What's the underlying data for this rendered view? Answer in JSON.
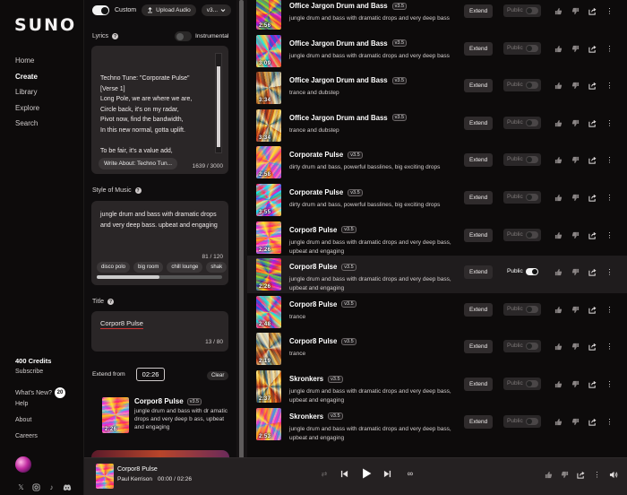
{
  "brand": "SUNO",
  "nav": [
    "Home",
    "Create",
    "Library",
    "Explore",
    "Search"
  ],
  "side_bottom": {
    "credits": "400 Credits",
    "subscribe": "Subscribe",
    "whats_new": "What's New?",
    "whats_new_count": "20",
    "help": "Help",
    "about": "About",
    "careers": "Careers"
  },
  "create": {
    "custom_label": "Custom",
    "upload_label": "Upload Audio",
    "version_label": "v3...",
    "lyrics_label": "Lyrics",
    "instrumental_label": "Instrumental",
    "lyrics_text": "Techno Tune: \"Corporate Pulse\"\n[Verse 1]\nLong Pole, we are where we are,\nCircle back, it's on my radar,\nPivot now, find the bandwidth,\nIn this new normal, gotta uplift.\n\nTo be fair, it's a value add,",
    "write_about": "Write About: Techno Tun...",
    "lyrics_count": "1639 / 3000",
    "style_label": "Style of Music",
    "style_text": "jungle drum and bass with dramatic drops and very deep bass.  upbeat and engaging",
    "style_count": "81 / 120",
    "chips": [
      "disco polo",
      "big room",
      "chill lounge",
      "shak"
    ],
    "title_label": "Title",
    "title_value": "Corpor8 Pulse",
    "title_count": "13 / 80",
    "extend_from_label": "Extend from",
    "extend_time": "02:26",
    "clear_label": "Clear",
    "extend_song": {
      "title": "Corpor8 Pulse",
      "version": "v3.5",
      "desc": "jungle drum and bass with dr amatic drops and very deep b ass, upbeat and engaging",
      "duration": "2:26"
    }
  },
  "songs": [
    {
      "title": "Office Jargon Drum and Bass",
      "version": "v3.5",
      "desc": "jungle drum and bass with dramatic drops and very deep bass",
      "duration": "2:56",
      "public": false,
      "extend": "Extend",
      "public_label": "Public"
    },
    {
      "title": "Office Jargon Drum and Bass",
      "version": "v3.5",
      "desc": "jungle drum and bass with dramatic drops and very deep bass",
      "duration": "3:09",
      "public": false,
      "extend": "Extend",
      "public_label": "Public"
    },
    {
      "title": "Office Jargon Drum and Bass",
      "version": "v3.5",
      "desc": "trance and dubstep",
      "duration": "3:34",
      "public": false,
      "extend": "Extend",
      "public_label": "Public"
    },
    {
      "title": "Office Jargon Drum and Bass",
      "version": "v3.5",
      "desc": "trance and dubstep",
      "duration": "3:34",
      "public": false,
      "extend": "Extend",
      "public_label": "Public"
    },
    {
      "title": "Corporate Pulse",
      "version": "v3.5",
      "desc": "dirty drum and bass, powerful basslines, big exciting drops",
      "duration": "2:58",
      "public": false,
      "extend": "Extend",
      "public_label": "Public"
    },
    {
      "title": "Corporate Pulse",
      "version": "v3.5",
      "desc": "dirty drum and bass, powerful basslines, big exciting drops",
      "duration": "3:55",
      "public": false,
      "extend": "Extend",
      "public_label": "Public"
    },
    {
      "title": "Corpor8 Pulse",
      "version": "v3.5",
      "desc": "jungle drum and bass with dramatic drops and very deep bass, upbeat and engaging",
      "duration": "2:26",
      "public": false,
      "extend": "Extend",
      "public_label": "Public"
    },
    {
      "title": "Corpor8 Pulse",
      "version": "v3.5",
      "desc": "jungle drum and bass with dramatic drops and very deep bass, upbeat and engaging",
      "duration": "2:26",
      "public": true,
      "extend": "Extend",
      "public_label": "Public"
    },
    {
      "title": "Corpor8 Pulse",
      "version": "v3.5",
      "desc": "trance",
      "duration": "2:48",
      "public": false,
      "extend": "Extend",
      "public_label": "Public"
    },
    {
      "title": "Corpor8 Pulse",
      "version": "v3.5",
      "desc": "trance",
      "duration": "2:19",
      "public": false,
      "extend": "Extend",
      "public_label": "Public"
    },
    {
      "title": "Skronkers",
      "version": "v3.5",
      "desc": "jungle drum and bass with dramatic drops and very deep bass, upbeat and engaging",
      "duration": "2:37",
      "public": false,
      "extend": "Extend",
      "public_label": "Public"
    },
    {
      "title": "Skronkers",
      "version": "v3.5",
      "desc": "jungle drum and bass with dramatic drops and very deep bass, upbeat and engaging",
      "duration": "2:53",
      "public": false,
      "extend": "Extend",
      "public_label": "Public"
    }
  ],
  "player": {
    "title": "Corpor8 Pulse",
    "artist": "Paul Kerrison",
    "time": "00:00 / 02:26"
  },
  "icons": {
    "thumb_up": "thumbs-up-icon",
    "thumb_down": "thumbs-down-icon",
    "share": "share-icon",
    "more": "more-icon"
  },
  "colors": {
    "background": "#0c0a0b",
    "panel": "#2a2627",
    "accent_underline": "#cc3333",
    "highlight_row": "#1f1c1d"
  }
}
